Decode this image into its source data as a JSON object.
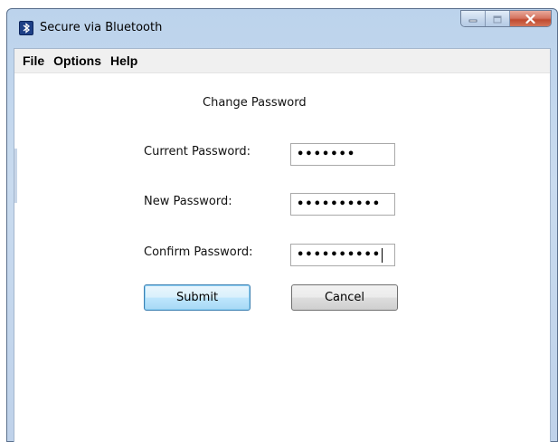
{
  "window": {
    "title": "Secure via Bluetooth",
    "controls": [
      "minimize",
      "maximize",
      "close"
    ]
  },
  "menu": {
    "items": [
      "File",
      "Options",
      "Help"
    ]
  },
  "form": {
    "heading": "Change Password",
    "current_label": "Current Password:",
    "current_value": "•••••••",
    "new_label": "New Password:",
    "new_value": "••••••••••",
    "confirm_label": "Confirm Password:",
    "confirm_value": "••••••••••",
    "submit_label": "Submit",
    "cancel_label": "Cancel"
  },
  "colors": {
    "titlebar": "#c9dbef",
    "close_button": "#c04a30",
    "submit_border": "#3c7fb1"
  },
  "icons": {
    "app": "bluetooth-app-icon",
    "minimize": "minimize-icon",
    "maximize": "maximize-icon",
    "close": "close-icon"
  }
}
